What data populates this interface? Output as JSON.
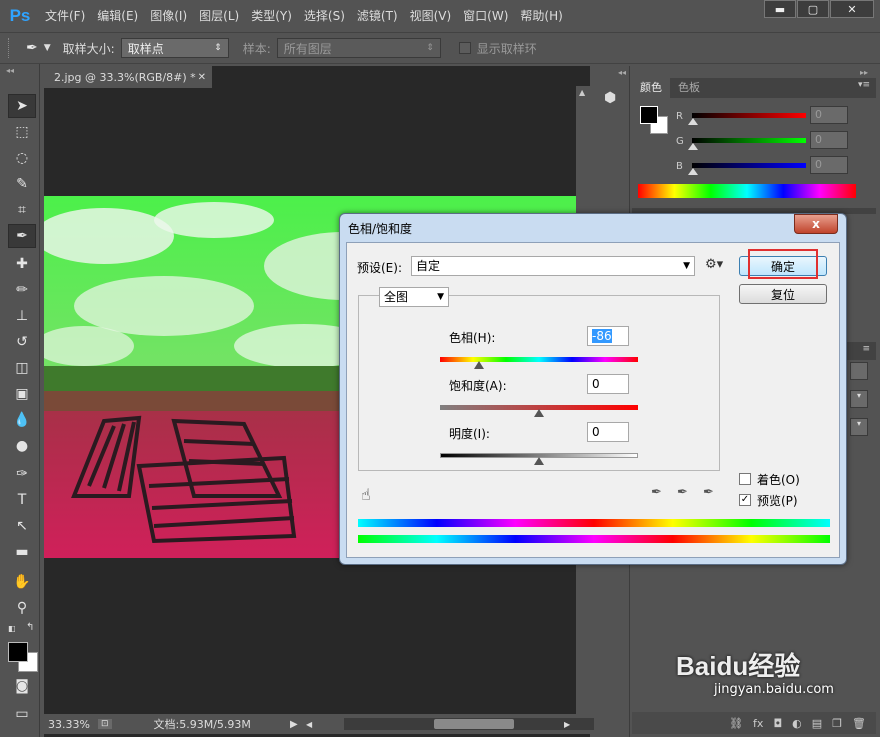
{
  "app": {
    "logo": "Ps"
  },
  "menu": [
    "文件(F)",
    "编辑(E)",
    "图像(I)",
    "图层(L)",
    "类型(Y)",
    "选择(S)",
    "滤镜(T)",
    "视图(V)",
    "窗口(W)",
    "帮助(H)"
  ],
  "options_bar": {
    "sample_size_label": "取样大小:",
    "sample_size_value": "取样点",
    "sample_label": "样本:",
    "sample_value": "所有图层",
    "show_ring_label": "显示取样环"
  },
  "document": {
    "tab_title": "2.jpg @ 33.3%(RGB/8#) *",
    "zoom": "33.33%",
    "doc_size": "文档:5.93M/5.93M"
  },
  "color_panel": {
    "tabs": [
      "颜色",
      "色板"
    ],
    "r_label": "R",
    "g_label": "G",
    "b_label": "B",
    "r_value": "0",
    "g_value": "0",
    "b_value": "0"
  },
  "dialog": {
    "title": "色相/饱和度",
    "close": "x",
    "preset_label": "预设(E):",
    "preset_value": "自定",
    "ok_label": "确定",
    "reset_label": "复位",
    "channel": "全图",
    "hue_label": "色相(H):",
    "hue_value": "-86",
    "sat_label": "饱和度(A):",
    "sat_value": "0",
    "light_label": "明度(I):",
    "light_value": "0",
    "colorize_label": "着色(O)",
    "preview_label": "预览(P)",
    "preview_checked": true,
    "colorize_checked": false
  },
  "watermark": {
    "main": "Baidu经验",
    "sub": "jingyan.baidu.com"
  },
  "colors": {
    "hue_slider_accent": "#ff0000",
    "ok_highlight": "#e03030"
  }
}
